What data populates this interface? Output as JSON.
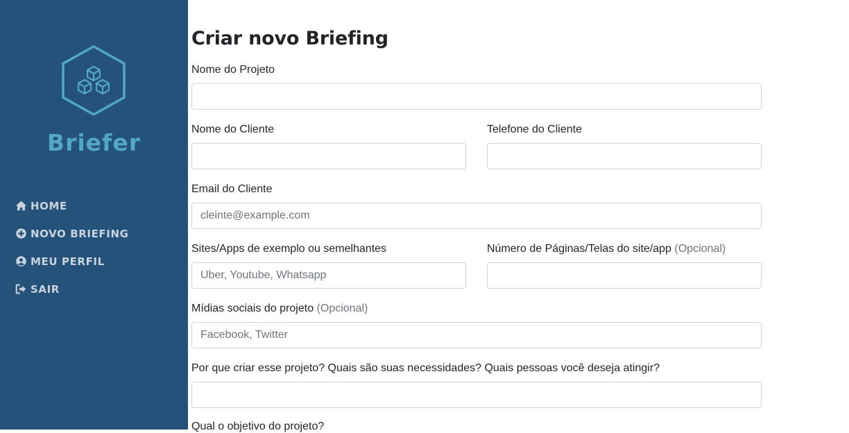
{
  "sidebar": {
    "brand": "Briefer",
    "logo_icon": "hexagon-cubes-logo",
    "colors": {
      "background": "#24527a",
      "accent": "#52a8c2",
      "nav_text": "#c8d3de"
    },
    "nav": [
      {
        "label": "HOME",
        "icon": "home-icon"
      },
      {
        "label": "NOVO BRIEFING",
        "icon": "plus-circle-icon"
      },
      {
        "label": "MEU PERFIL",
        "icon": "user-circle-icon"
      },
      {
        "label": "SAIR",
        "icon": "sign-out-icon"
      }
    ]
  },
  "form": {
    "title": "Criar novo Briefing",
    "optional_tag": "(Opcional)",
    "fields": {
      "project_name": {
        "label": "Nome do Projeto",
        "value": "",
        "placeholder": ""
      },
      "client_name": {
        "label": "Nome do Cliente",
        "value": "",
        "placeholder": ""
      },
      "client_phone": {
        "label": "Telefone do Cliente",
        "value": "",
        "placeholder": ""
      },
      "client_email": {
        "label": "Email do Cliente",
        "value": "",
        "placeholder": "cleinte@example.com"
      },
      "example_sites": {
        "label": "Sites/Apps de exemplo ou semelhantes",
        "value": "",
        "placeholder": "Uber, Youtube, Whatsapp"
      },
      "page_count": {
        "label": "Número de Páginas/Telas do site/app",
        "value": "",
        "placeholder": ""
      },
      "social_media": {
        "label": "Mídias sociais do projeto",
        "value": "",
        "placeholder": "Facebook, Twitter"
      },
      "why_project": {
        "label": "Por que criar esse projeto? Quais são suas necessidades? Quais pessoas você deseja atingir?",
        "value": "",
        "placeholder": ""
      },
      "objective": {
        "label": "Qual o objetivo do projeto?"
      }
    }
  }
}
